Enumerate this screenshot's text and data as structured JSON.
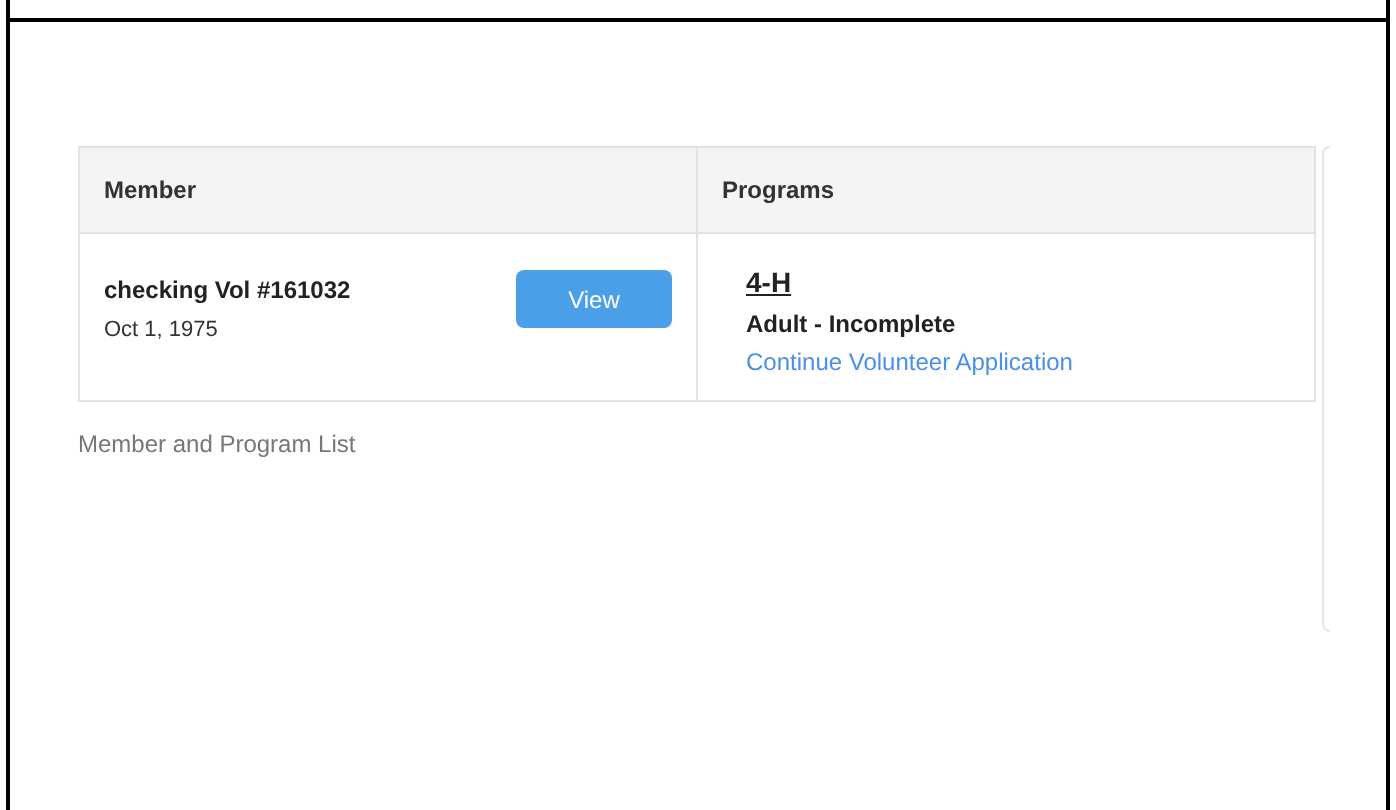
{
  "table": {
    "columns": [
      "Member",
      "Programs"
    ],
    "rows": [
      {
        "member_name": "checking Vol #161032",
        "member_date": "Oct 1, 1975",
        "action": "View",
        "program": "4-H",
        "status": "Adult - Incomplete",
        "link": "Continue Volunteer Application"
      }
    ]
  },
  "caption": "Member and Program List"
}
